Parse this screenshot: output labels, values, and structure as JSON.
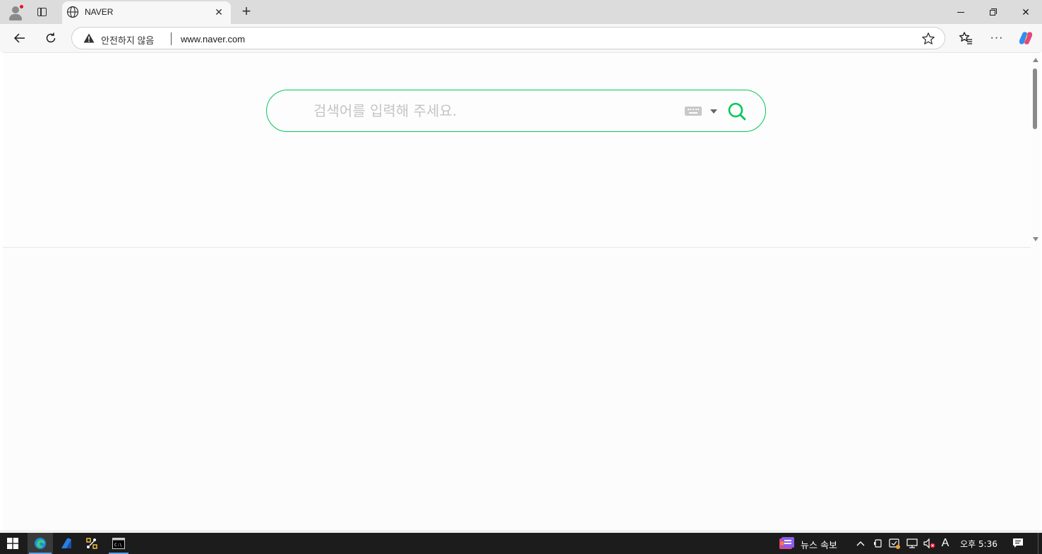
{
  "browser": {
    "tab": {
      "title": "NAVER",
      "close_glyph": "✕"
    },
    "new_tab_glyph": "+",
    "window_controls": {
      "close_glyph": "✕"
    },
    "addressbar": {
      "security_label": "안전하지 않음",
      "url": "www.naver.com"
    },
    "more_glyph": "···"
  },
  "page": {
    "search": {
      "placeholder": "검색어를 입력해 주세요.",
      "value": ""
    },
    "colors": {
      "accent": "#03c75a"
    }
  },
  "taskbar": {
    "news_label": "뉴스 속보",
    "ime_glyph": "A",
    "clock": "오후 5:36"
  }
}
